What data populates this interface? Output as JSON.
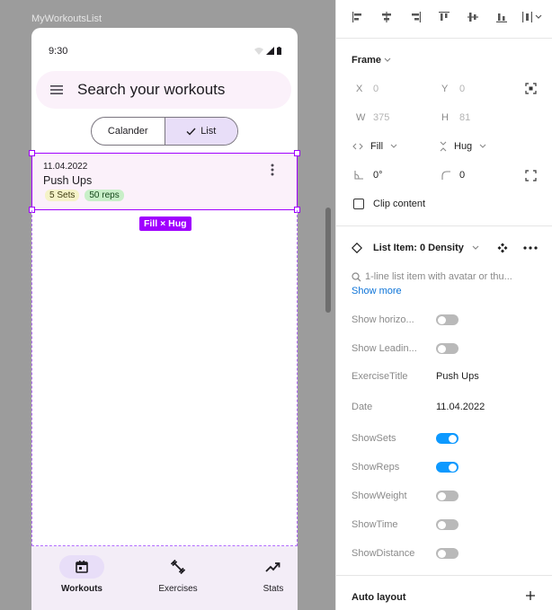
{
  "canvas": {
    "frame_label": "MyWorkoutsList",
    "phone": {
      "time": "9:30",
      "search_placeholder": "Search your workouts",
      "segmented": {
        "left": "Calander",
        "right": "List"
      },
      "list_item": {
        "date": "11.04.2022",
        "title": "Push Ups",
        "chip_sets": "5 Sets",
        "chip_reps": "50 reps"
      },
      "selection_badge": "Fill × Hug",
      "nav": [
        {
          "label": "Workouts",
          "icon": "calendar-icon",
          "active": true
        },
        {
          "label": "Exercises",
          "icon": "dumbbell-icon",
          "active": false
        },
        {
          "label": "Stats",
          "icon": "trending-up-icon",
          "active": false
        }
      ]
    }
  },
  "panel": {
    "frame": {
      "heading": "Frame",
      "x_label": "X",
      "x_value": "0",
      "y_label": "Y",
      "y_value": "0",
      "w_label": "W",
      "w_value": "375",
      "h_label": "H",
      "h_value": "81",
      "width_mode": "Fill",
      "height_mode": "Hug",
      "rotation": "0°",
      "radius": "0",
      "clip_label": "Clip content"
    },
    "component": {
      "name": "List Item: 0 Density",
      "description": "1-line list item with avatar or thu...",
      "show_more": "Show more",
      "props": [
        {
          "label": "Show horizo...",
          "type": "toggle",
          "on": false
        },
        {
          "label": "Show Leadin...",
          "type": "toggle",
          "on": false
        },
        {
          "label": "ExerciseTitle",
          "type": "text",
          "value": "Push Ups"
        },
        {
          "label": "Date",
          "type": "text",
          "value": "11.04.2022"
        },
        {
          "label": "ShowSets",
          "type": "toggle",
          "on": true
        },
        {
          "label": "ShowReps",
          "type": "toggle",
          "on": true
        },
        {
          "label": "ShowWeight",
          "type": "toggle",
          "on": false
        },
        {
          "label": "ShowTime",
          "type": "toggle",
          "on": false
        },
        {
          "label": "ShowDistance",
          "type": "toggle",
          "on": false
        }
      ]
    },
    "auto_layout": {
      "heading": "Auto layout"
    }
  },
  "colors": {
    "selection": "#a000ff",
    "toggle_on": "#0d99ff",
    "secondary_container": "#e8def8"
  }
}
